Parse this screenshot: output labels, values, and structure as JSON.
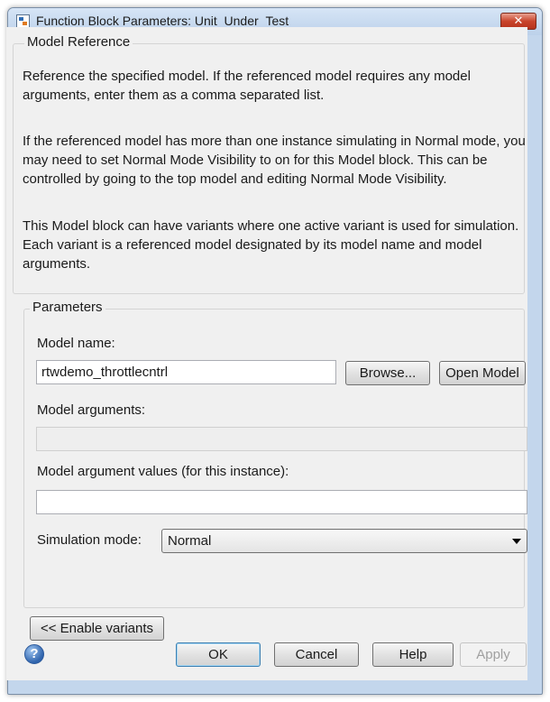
{
  "window": {
    "title": "Function Block Parameters: Unit_Under_Test",
    "close_glyph": "✕"
  },
  "model_reference": {
    "legend": "Model Reference",
    "paragraphs": [
      "Reference the specified model.  If the referenced model requires any model arguments, enter them as a comma separated list.",
      "If the referenced model has more than one instance simulating in Normal mode, you may need to set Normal Mode Visibility to on for this Model block.  This can be controlled by going to the top model and editing Normal Mode Visibility.",
      "This Model block can have variants where one active variant is used for simulation. Each variant is a referenced model designated by its model name and model arguments."
    ]
  },
  "parameters": {
    "legend": "Parameters",
    "model_name_label": "Model name:",
    "model_name_value": "rtwdemo_throttlecntrl",
    "browse_label": "Browse...",
    "open_model_label": "Open Model",
    "model_arguments_label": "Model arguments:",
    "model_arguments_value": "",
    "arg_values_label": "Model argument values (for this instance):",
    "arg_values_value": "",
    "sim_mode_label": "Simulation mode:",
    "sim_mode_value": "Normal"
  },
  "enable_variants_label": "<< Enable variants",
  "footer": {
    "help_icon": "question-circle-icon",
    "ok_label": "OK",
    "cancel_label": "Cancel",
    "help_label": "Help",
    "apply_label": "Apply"
  }
}
